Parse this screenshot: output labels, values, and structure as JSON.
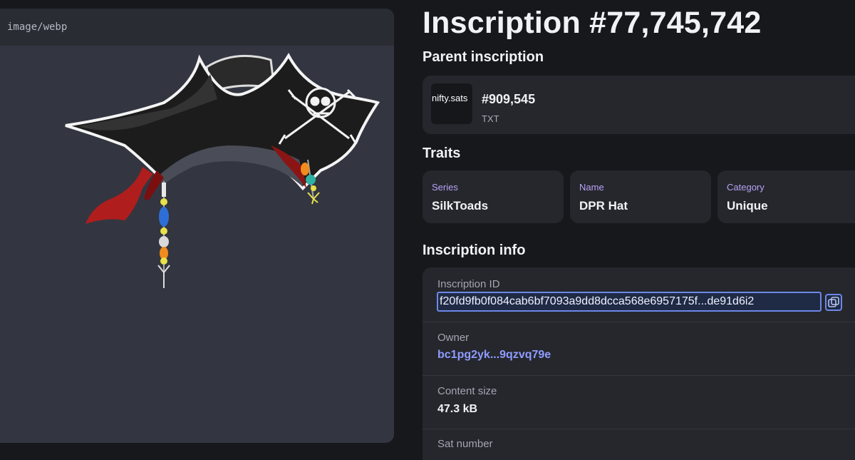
{
  "media": {
    "mime_type": "image/webp"
  },
  "page_title": "Inscription #77,745,742",
  "parent": {
    "section_title": "Parent inscription",
    "thumb_text": "nifty.sats",
    "number": "#909,545",
    "type": "TXT"
  },
  "traits": {
    "section_title": "Traits",
    "items": [
      {
        "label": "Series",
        "value": "SilkToads"
      },
      {
        "label": "Name",
        "value": "DPR Hat"
      },
      {
        "label": "Category",
        "value": "Unique"
      }
    ]
  },
  "info": {
    "section_title": "Inscription info",
    "inscription_id_label": "Inscription ID",
    "inscription_id_value": "f20fd9fb0f084cab6bf7093a9dd8dcca568e6957175f...de91d6i2",
    "owner_label": "Owner",
    "owner_value": "bc1pg2yk...9qzvq79e",
    "content_size_label": "Content size",
    "content_size_value": "47.3 kB",
    "sat_number_label": "Sat number"
  },
  "colors": {
    "background": "#17181c",
    "card": "#25272d",
    "trait_label": "#b9a2f5",
    "link": "#8f9bff",
    "focus_border": "#6d88e6"
  }
}
